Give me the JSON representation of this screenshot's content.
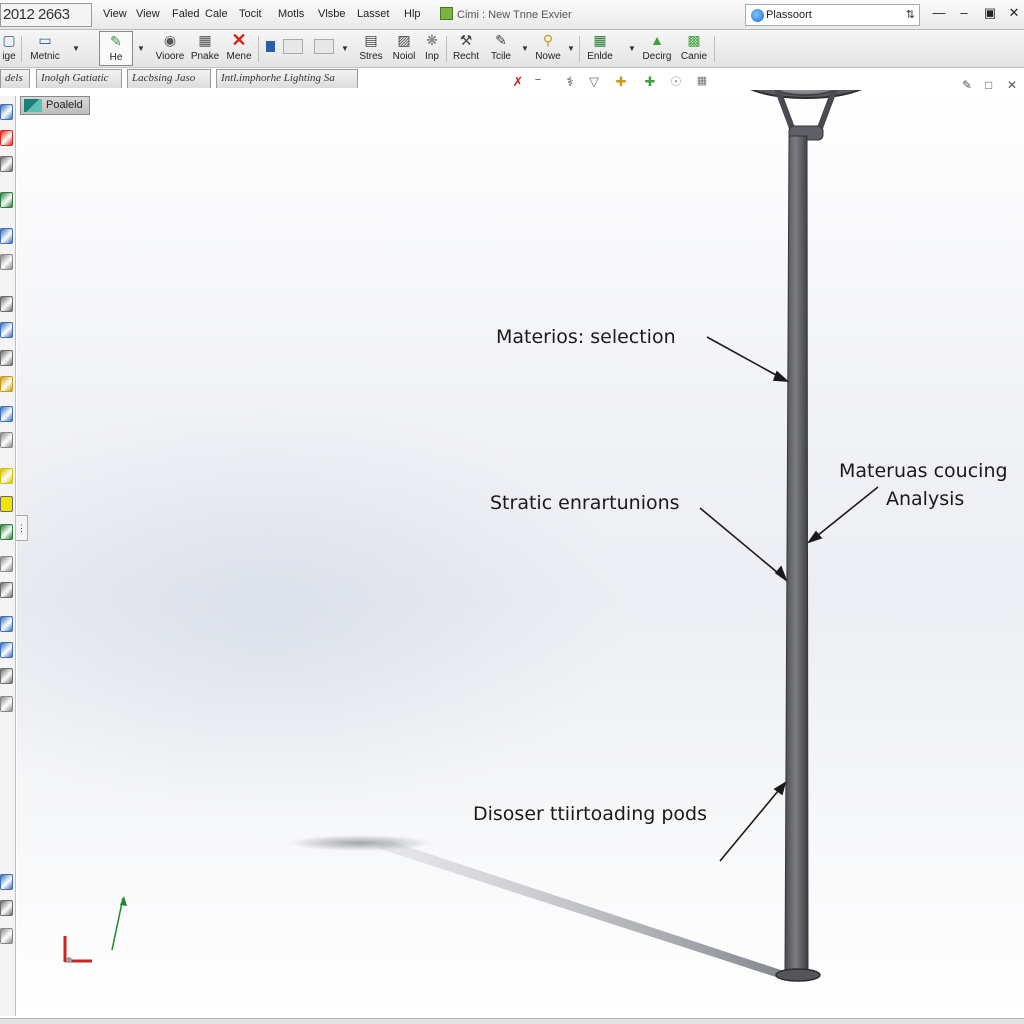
{
  "app": {
    "title": "2012 2663"
  },
  "menu": [
    "View",
    "View",
    "Faled",
    "Cale",
    "Tocit",
    "Motls",
    "Vlsbe",
    "Lasset",
    "Hlp"
  ],
  "document": {
    "title": "Cimi : New Tnne Exvier"
  },
  "search": {
    "value": "Plassoort",
    "go_label": "⇅"
  },
  "window_controls": [
    "—",
    "–",
    "▣",
    "✕"
  ],
  "toolbar": {
    "left_cut_label": "ige",
    "buttons": [
      {
        "label": "Metnic",
        "icon": "rectangle-icon"
      },
      {
        "label": "He",
        "icon": "sketch-icon"
      },
      {
        "label": "Vioore",
        "icon": "revolve-icon"
      },
      {
        "label": "Pnake",
        "icon": "grid-icon"
      },
      {
        "label": "Mene",
        "icon": "delete-x-icon"
      },
      {
        "label": "Stres",
        "icon": "stress-icon"
      },
      {
        "label": "Noiol",
        "icon": "mesh-icon"
      },
      {
        "label": "Inp",
        "icon": "insert-icon"
      },
      {
        "label": "Recht",
        "icon": "result-icon"
      },
      {
        "label": "Tcile",
        "icon": "tools-icon"
      },
      {
        "label": "Nowe",
        "icon": "study-icon"
      },
      {
        "label": "Enlde",
        "icon": "report-icon"
      },
      {
        "label": "Decirg",
        "icon": "design-icon"
      },
      {
        "label": "Canie",
        "icon": "chart-icon"
      }
    ]
  },
  "tabs": [
    {
      "label": "dels"
    },
    {
      "label": "Inolgh Gatiatic"
    },
    {
      "label": "Lacbsing Jaso"
    },
    {
      "label": "Intl.imphorhe Lighting Sa"
    }
  ],
  "feature_manager": {
    "label": "Poaleld"
  },
  "callouts": {
    "material_selection": "Materios: selection",
    "material_analysis_1": "Materuas coucing",
    "material_analysis_2": "Analysis",
    "static_analysis": "Stratic enrartunions",
    "loading": "Disoser ttiirtoading pods"
  },
  "colors": {
    "pole": "#55565a",
    "pole_highlight": "#8a8b90",
    "luminaire_rim": "#4a4b50",
    "axis_x": "#d22020",
    "axis_y": "#1c8a2c",
    "accent_toolbar_red": "#d8261c",
    "accent_toolbar_green": "#3ea13a"
  }
}
